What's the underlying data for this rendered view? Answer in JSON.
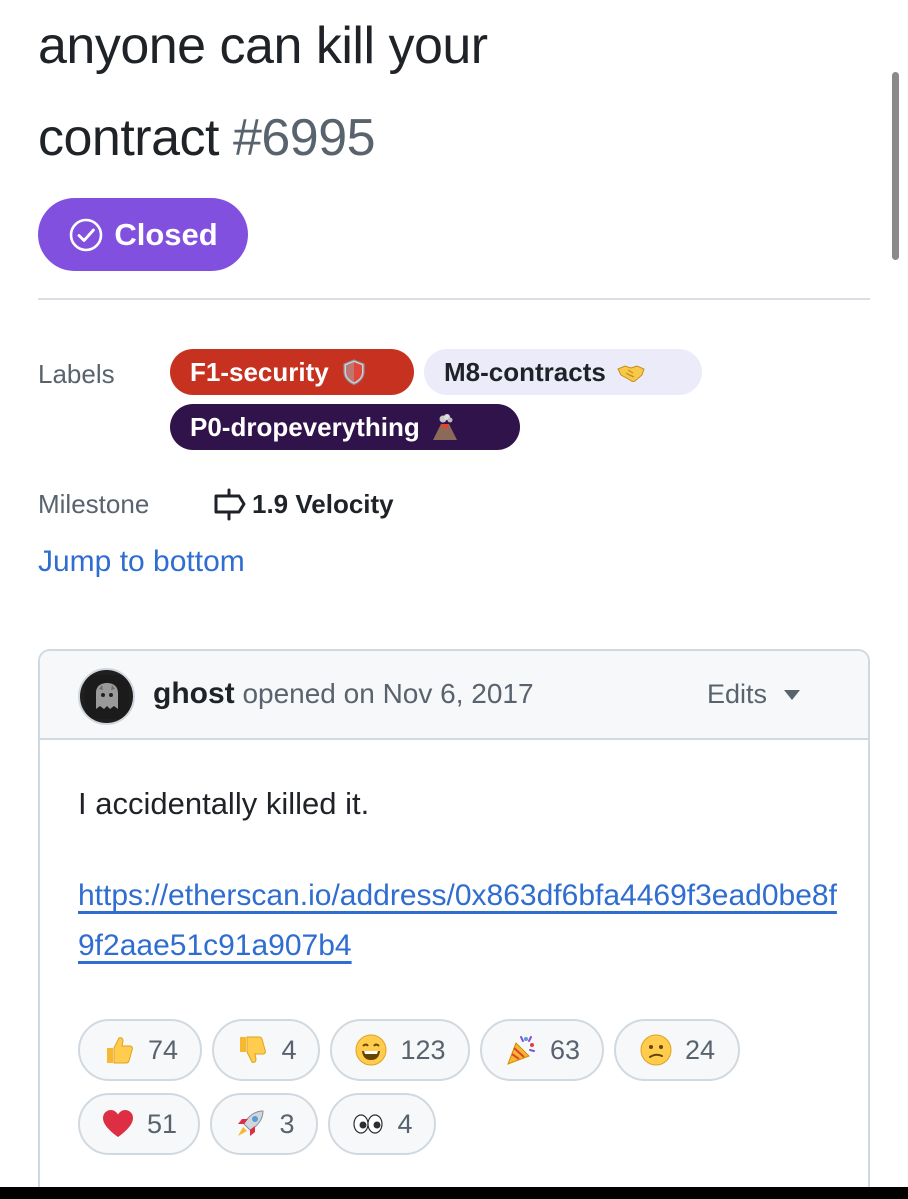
{
  "issue": {
    "title_text": "anyone can kill your contract",
    "title_line1": "anyone can kill your",
    "title_line2": "contract",
    "number": "#6995",
    "state": "Closed"
  },
  "sidebar": {
    "labels_title": "Labels",
    "labels": [
      {
        "name": "F1-security",
        "color": "#c73220",
        "icon": "shield-icon"
      },
      {
        "name": "M8-contracts",
        "color": "#ecebfa",
        "icon": "handshake-icon"
      },
      {
        "name": "P0-dropeverything",
        "color": "#30134a",
        "icon": "volcano-icon"
      }
    ],
    "milestone_title": "Milestone",
    "milestone": "1.9 Velocity",
    "jump_link": "Jump to bottom"
  },
  "comment": {
    "author": "ghost",
    "action": "opened on Nov 6, 2017",
    "edits_label": "Edits",
    "body": "I accidentally killed it.",
    "link": "https://etherscan.io/address/0x863df6bfa4469f3ead0be8f9f2aae51c91a907b4"
  },
  "reactions": [
    {
      "icon": "thumbs-up-icon",
      "count": "74"
    },
    {
      "icon": "thumbs-down-icon",
      "count": "4"
    },
    {
      "icon": "laugh-icon",
      "count": "123"
    },
    {
      "icon": "hooray-icon",
      "count": "63"
    },
    {
      "icon": "confused-icon",
      "count": "24"
    },
    {
      "icon": "heart-icon",
      "count": "51"
    },
    {
      "icon": "rocket-icon",
      "count": "3"
    },
    {
      "icon": "eyes-icon",
      "count": "4"
    }
  ],
  "colors": {
    "closed_badge": "#8250df",
    "link": "#2f6dd0",
    "muted_text": "#59636e"
  }
}
